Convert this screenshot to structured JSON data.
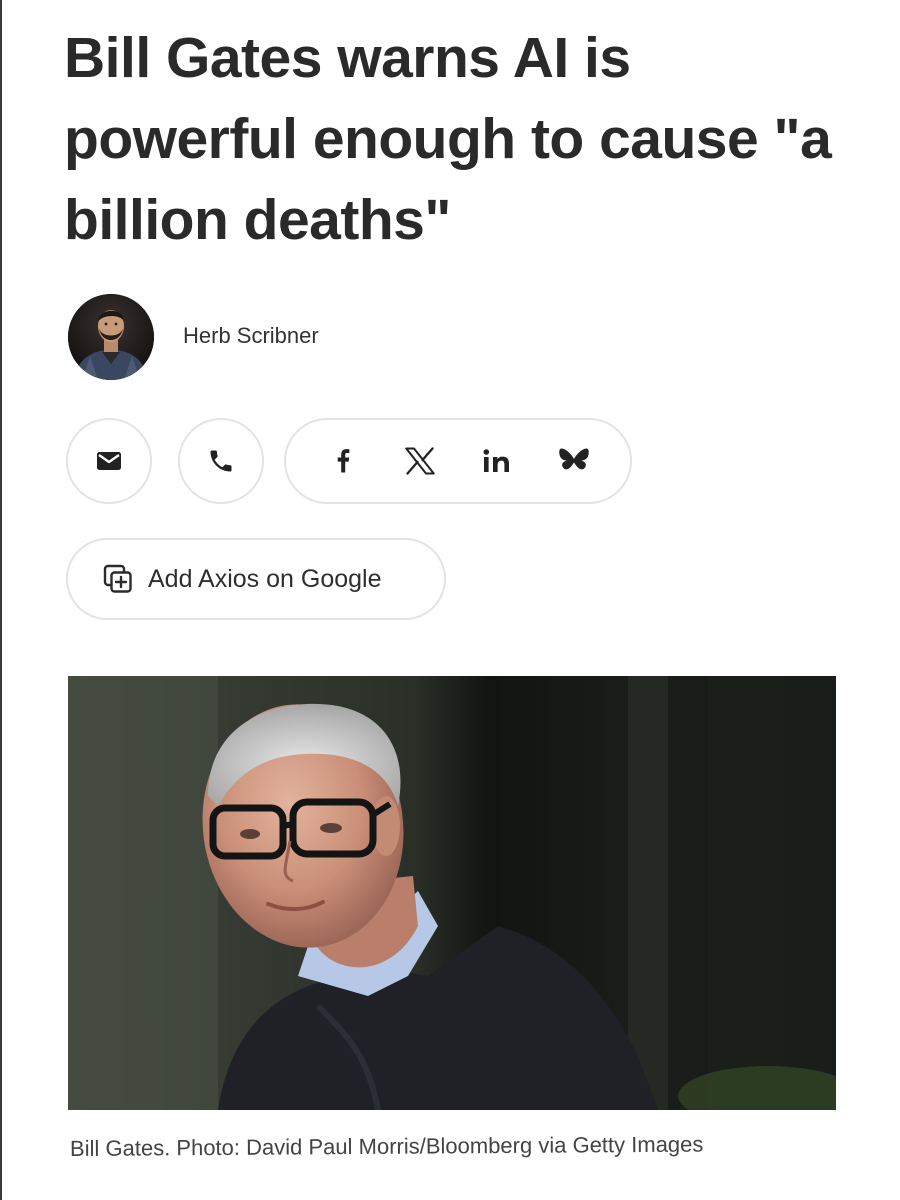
{
  "article": {
    "headline": "Bill Gates warns AI is powerful enough to cause \"a billion deaths\"",
    "author": {
      "name": "Herb Scribner"
    },
    "share": {
      "icons": [
        "mail-icon",
        "phone-icon",
        "facebook-icon",
        "x-icon",
        "linkedin-icon",
        "bluesky-icon"
      ]
    },
    "add_google_label": "Add Axios on Google",
    "photo_caption": "Bill Gates. Photo: David Paul Morris/Bloomberg via Getty Images"
  },
  "colors": {
    "text": "#2a2a2a",
    "border": "#e3e3e3",
    "background": "#ffffff"
  }
}
